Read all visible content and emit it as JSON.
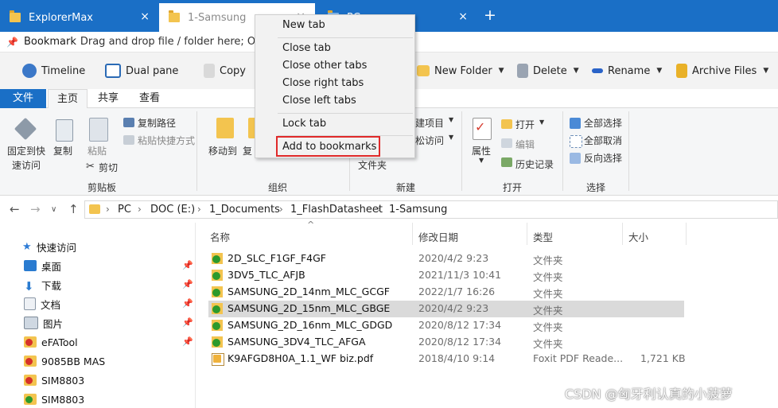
{
  "tabs": [
    {
      "label": "ExplorerMax",
      "state": "inactive"
    },
    {
      "label": "1-Samsung",
      "state": "active"
    },
    {
      "label": "PC",
      "state": "inactive"
    }
  ],
  "tab_close": "×",
  "new_tab": "+",
  "bookmark_bar": {
    "label": "Bookmark",
    "hint": "Drag and drop file / folder here; Or righ"
  },
  "toolbar": [
    {
      "label": "Timeline",
      "icon": "clock-icon"
    },
    {
      "label": "Dual pane",
      "icon": "dual-pane-icon"
    },
    {
      "label": "Copy",
      "icon": "copy-icon"
    },
    {
      "label": "New Folder",
      "icon": "new-folder-icon",
      "dropdown": true
    },
    {
      "label": "Delete",
      "icon": "trash-icon",
      "dropdown": true
    },
    {
      "label": "Rename",
      "icon": "rename-icon",
      "dropdown": true
    },
    {
      "label": "Archive Files",
      "icon": "archive-icon",
      "dropdown": true
    }
  ],
  "ribbon_tabs": [
    "文件",
    "主页",
    "共享",
    "查看"
  ],
  "ribbon": {
    "clipboard": {
      "pin": [
        "固定到快",
        "速访问"
      ],
      "copy": "复制",
      "paste": "粘贴",
      "copy_path": "复制路径",
      "paste_shortcut": "粘贴快捷方式",
      "cut": "剪切",
      "group": "剪贴板"
    },
    "organize": {
      "move_to": "移动到",
      "copy_to": "复",
      "group": "组织"
    },
    "new": {
      "new_item": "建项目",
      "easy_access": "松访问",
      "folder": "文件夹",
      "group": "新建"
    },
    "open": {
      "properties": "属性",
      "open": "打开",
      "edit": "编辑",
      "history": "历史记录",
      "group": "打开"
    },
    "select": {
      "select_all": "全部选择",
      "select_none": "全部取消",
      "invert": "反向选择",
      "group": "选择"
    }
  },
  "address": {
    "crumbs": [
      "PC",
      "DOC (E:)",
      "1_Documents",
      "1_FlashDatasheet",
      "1-Samsung"
    ],
    "back": "←",
    "forward": "→",
    "up": "↑",
    "expand": "∨",
    "sep": "›"
  },
  "nav_pane": [
    {
      "label": "快速访问",
      "icon": "star-icon",
      "pinned": false
    },
    {
      "label": "桌面",
      "icon": "desktop-icon",
      "pinned": true
    },
    {
      "label": "下载",
      "icon": "download-icon",
      "pinned": true
    },
    {
      "label": "文档",
      "icon": "document-icon",
      "pinned": true
    },
    {
      "label": "图片",
      "icon": "picture-icon",
      "pinned": true
    },
    {
      "label": "eFATool",
      "icon": "folder-alert-icon",
      "pinned": true
    },
    {
      "label": "9085BB MAS",
      "icon": "folder-alert-icon",
      "pinned": false
    },
    {
      "label": "SIM8803",
      "icon": "folder-alert-icon",
      "pinned": false
    },
    {
      "label": "SIM8803",
      "icon": "folder-check-icon",
      "pinned": false
    }
  ],
  "pin_glyph": "📌",
  "columns": [
    "名称",
    "修改日期",
    "类型",
    "大小"
  ],
  "sort_glyph": "^",
  "files": [
    {
      "name": "2D_SLC_F1GF_F4GF",
      "date": "2020/4/2 9:23",
      "type": "文件夹",
      "size": "",
      "icon": "folder-check-icon"
    },
    {
      "name": "3DV5_TLC_AFJB",
      "date": "2021/11/3 10:41",
      "type": "文件夹",
      "size": "",
      "icon": "folder-check-icon"
    },
    {
      "name": "SAMSUNG_2D_14nm_MLC_GCGF",
      "date": "2022/1/7 16:26",
      "type": "文件夹",
      "size": "",
      "icon": "folder-check-icon"
    },
    {
      "name": "SAMSUNG_2D_15nm_MLC_GBGE",
      "date": "2020/4/2 9:23",
      "type": "文件夹",
      "size": "",
      "icon": "folder-check-icon",
      "selected": true
    },
    {
      "name": "SAMSUNG_2D_16nm_MLC_GDGD",
      "date": "2020/8/12 17:34",
      "type": "文件夹",
      "size": "",
      "icon": "folder-check-icon"
    },
    {
      "name": "SAMSUNG_3DV4_TLC_AFGA",
      "date": "2020/8/12 17:34",
      "type": "文件夹",
      "size": "",
      "icon": "folder-check-icon"
    },
    {
      "name": "K9AFGD8H0A_1.1_WF biz.pdf",
      "date": "2018/4/10 9:14",
      "type": "Foxit PDF Reade...",
      "size": "1,721 KB",
      "icon": "pdf-file-icon"
    }
  ],
  "context_menu": {
    "items": [
      "New tab",
      "Close tab",
      "Close other tabs",
      "Close right tabs",
      "Close left tabs",
      "Lock tab",
      "Add to bookmarks"
    ],
    "highlighted": "Add to bookmarks"
  },
  "watermark": "CSDN @匈牙利认真的小菠萝",
  "colors": {
    "accent": "#1a6fc6",
    "folder": "#f3c44f",
    "check": "#2c9a2c",
    "highlight_border": "#e02a2a",
    "selected_row": "#dadada"
  }
}
